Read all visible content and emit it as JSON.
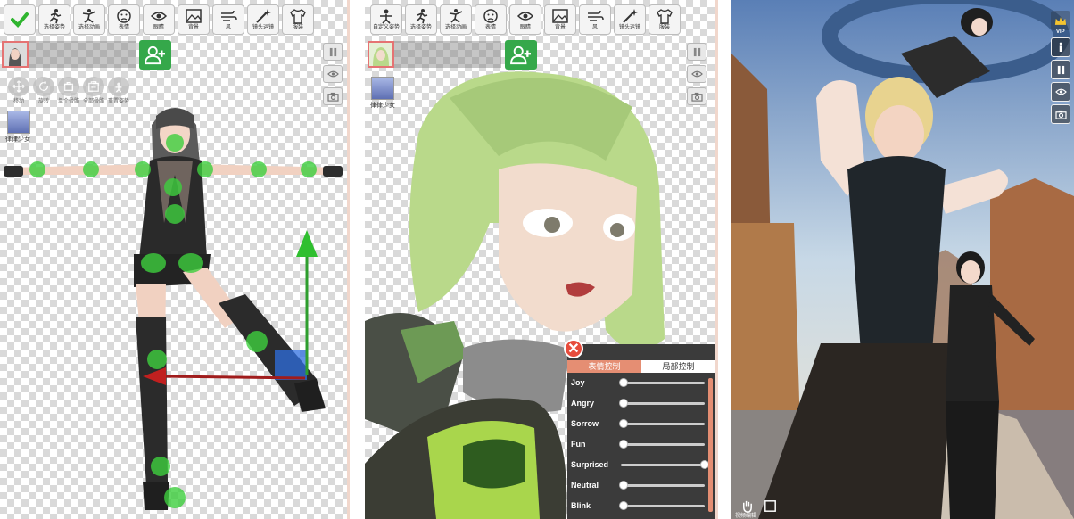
{
  "panel1": {
    "toolbar": [
      {
        "icon": "checkmark-icon",
        "label": ""
      },
      {
        "icon": "running-pose-icon",
        "label": "选择姿势"
      },
      {
        "icon": "dance-animation-icon",
        "label": "选择动画"
      },
      {
        "icon": "face-expression-icon",
        "label": "表情"
      },
      {
        "icon": "eye-icon",
        "label": "眼睛"
      },
      {
        "icon": "background-image-icon",
        "label": "背景"
      },
      {
        "icon": "wind-icon",
        "label": "风"
      },
      {
        "icon": "magic-camera-icon",
        "label": "镜头运镜"
      },
      {
        "icon": "shirt-icon",
        "label": "服装"
      }
    ],
    "mini_tools": [
      {
        "icon": "move-icon",
        "label": "移动"
      },
      {
        "icon": "rotate-icon",
        "label": "旋转"
      },
      {
        "icon": "single-pose-icon",
        "label": "单个骨骼"
      },
      {
        "icon": "full-pose-icon",
        "label": "全部骨骼"
      },
      {
        "icon": "reset-icon",
        "label": "重置姿势"
      }
    ],
    "character_thumb_label": "律律少女"
  },
  "panel2": {
    "toolbar": [
      {
        "icon": "custom-pose-icon",
        "label": "自定义姿势"
      },
      {
        "icon": "running-pose-icon",
        "label": "选择姿势"
      },
      {
        "icon": "dance-animation-icon",
        "label": "选择动画"
      },
      {
        "icon": "face-expression-icon",
        "label": "表情"
      },
      {
        "icon": "eye-icon",
        "label": "眼睛"
      },
      {
        "icon": "background-image-icon",
        "label": "背景"
      },
      {
        "icon": "wind-icon",
        "label": "风"
      },
      {
        "icon": "magic-camera-icon",
        "label": "镜头运镜"
      },
      {
        "icon": "shirt-icon",
        "label": "服装"
      }
    ],
    "character_thumb_label": "律律少女",
    "expression_panel": {
      "close_symbol": "✕",
      "tabs": [
        "表情控制",
        "局部控制"
      ],
      "active_tab": 0,
      "sliders": [
        {
          "label": "Joy",
          "value": 0
        },
        {
          "label": "Angry",
          "value": 0
        },
        {
          "label": "Sorrow",
          "value": 0
        },
        {
          "label": "Fun",
          "value": 0
        },
        {
          "label": "Surprised",
          "value": 1
        },
        {
          "label": "Neutral",
          "value": 0
        },
        {
          "label": "Blink",
          "value": 0
        }
      ]
    }
  },
  "panel3": {
    "vip_label": "VIP",
    "bottom_label": "视频编辑"
  },
  "colors": {
    "accent_green": "#35a84a",
    "accent_orange": "#e58e73",
    "close_red": "#e74c3c"
  }
}
